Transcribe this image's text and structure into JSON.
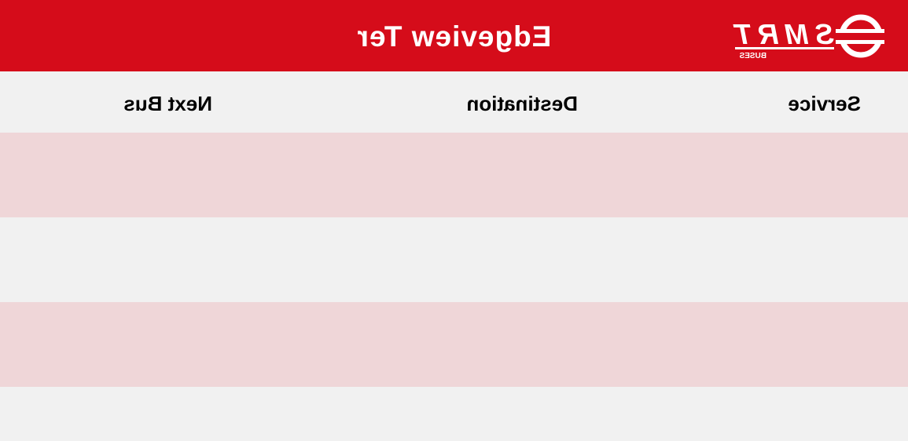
{
  "header": {
    "stop_name": "Edgeview Ter",
    "logo": {
      "brand": "SMRT",
      "sub": "BUSES",
      "icon": "smrt-logo-icon"
    }
  },
  "columns": {
    "service": "Service",
    "destination": "Destination",
    "next_bus": "Next Bus"
  },
  "rows": [
    {
      "service": "",
      "destination": "",
      "next_bus": ""
    },
    {
      "service": "",
      "destination": "",
      "next_bus": ""
    },
    {
      "service": "",
      "destination": "",
      "next_bus": ""
    },
    {
      "service": "",
      "destination": "",
      "next_bus": ""
    }
  ],
  "colors": {
    "header": "#d50c1a",
    "row_tint": "#efd6d8",
    "row_plain": "#f1f1f1"
  }
}
